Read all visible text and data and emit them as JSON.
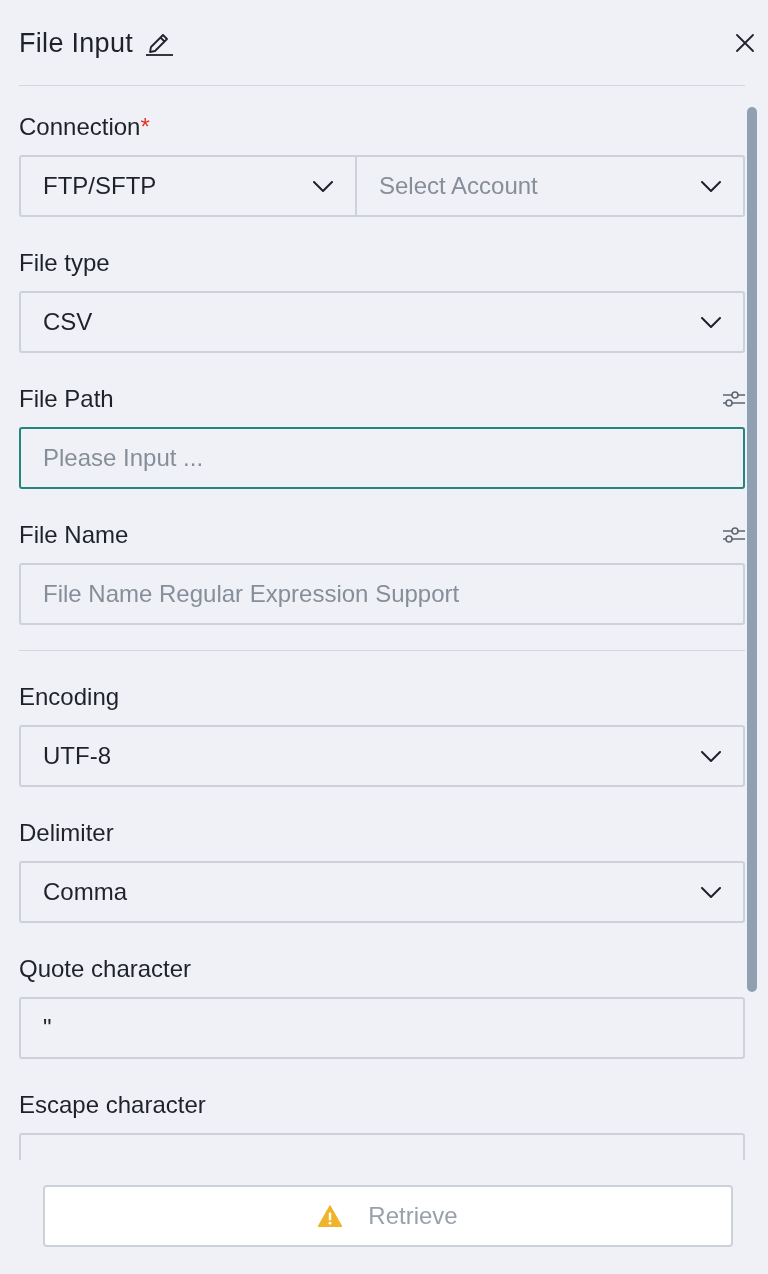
{
  "panel": {
    "title": "File Input"
  },
  "sections": [
    {
      "fields": [
        {
          "kind": "select_pair",
          "label": "Connection",
          "required_mark": "*",
          "options_icon": false,
          "selects": [
            {
              "value": "FTP/SFTP",
              "focused": false
            },
            {
              "placeholder": "Select Account",
              "focused": false
            }
          ]
        },
        {
          "kind": "select",
          "label": "File type",
          "value": "CSV",
          "focused": false,
          "options_icon": false
        },
        {
          "kind": "input",
          "label": "File Path",
          "placeholder": "Please Input ...",
          "focused": true,
          "options_icon": true
        },
        {
          "kind": "input",
          "label": "File Name",
          "placeholder": "File Name Regular Expression Support",
          "focused": false,
          "options_icon": true
        }
      ]
    },
    {
      "fields": [
        {
          "kind": "select",
          "label": "Encoding",
          "value": "UTF-8",
          "focused": false,
          "options_icon": false
        },
        {
          "kind": "select",
          "label": "Delimiter",
          "value": "Comma",
          "focused": false,
          "options_icon": false
        },
        {
          "kind": "input",
          "label": "Quote character",
          "value": "\"",
          "focused": false,
          "options_icon": false
        },
        {
          "kind": "input",
          "label": "Escape character",
          "focused": false,
          "options_icon": false
        }
      ]
    }
  ],
  "retrieve_button": {
    "label": "Retrieve",
    "disabled": true,
    "warning": true
  }
}
